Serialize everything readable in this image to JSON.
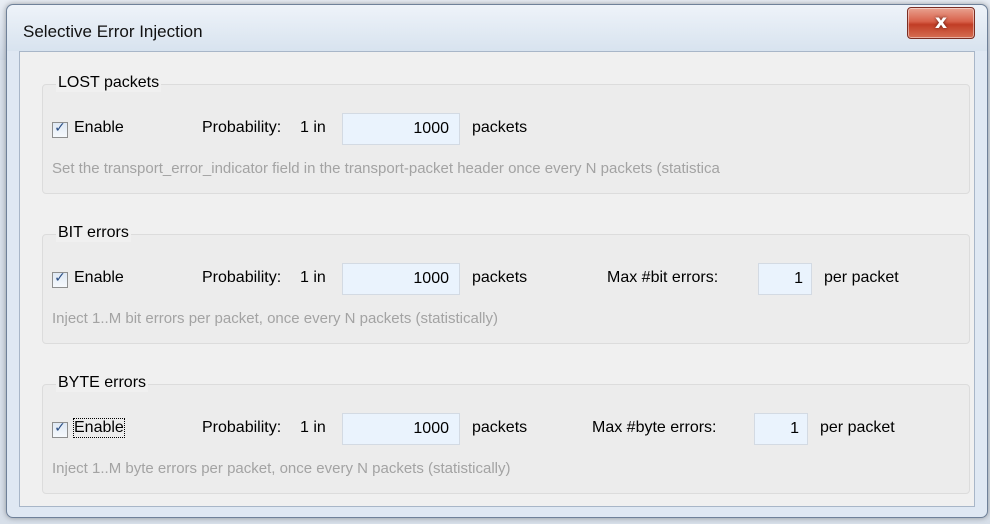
{
  "window": {
    "title": "Selective Error Injection",
    "close_symbol": "x"
  },
  "colors": {
    "close_button": "#c13d25",
    "field_background": "#eaf3fd",
    "description_text": "#a3a3a3"
  },
  "groups": [
    {
      "label": "LOST packets",
      "enable_label": "Enable",
      "enabled": true,
      "probability_label": "Probability:",
      "one_in_label": "1 in",
      "probability_value": "1000",
      "packets_label": "packets",
      "description": "Set the transport_error_indicator field in the transport-packet header once every N packets (statistica"
    },
    {
      "label": "BIT errors",
      "enable_label": "Enable",
      "enabled": true,
      "probability_label": "Probability:",
      "one_in_label": "1 in",
      "probability_value": "1000",
      "packets_label": "packets",
      "max_label": "Max #bit errors:",
      "max_value": "1",
      "per_packet_label": "per packet",
      "description": "Inject 1..M bit errors per packet, once every N packets (statistically)"
    },
    {
      "label": "BYTE errors",
      "enable_label": "Enable",
      "enabled": true,
      "probability_label": "Probability:",
      "one_in_label": "1 in",
      "probability_value": "1000",
      "packets_label": "packets",
      "max_label": "Max #byte errors:",
      "max_value": "1",
      "per_packet_label": "per packet",
      "description": "Inject 1..M byte errors per packet, once every N packets (statistically)"
    }
  ],
  "check_mark": "✓"
}
